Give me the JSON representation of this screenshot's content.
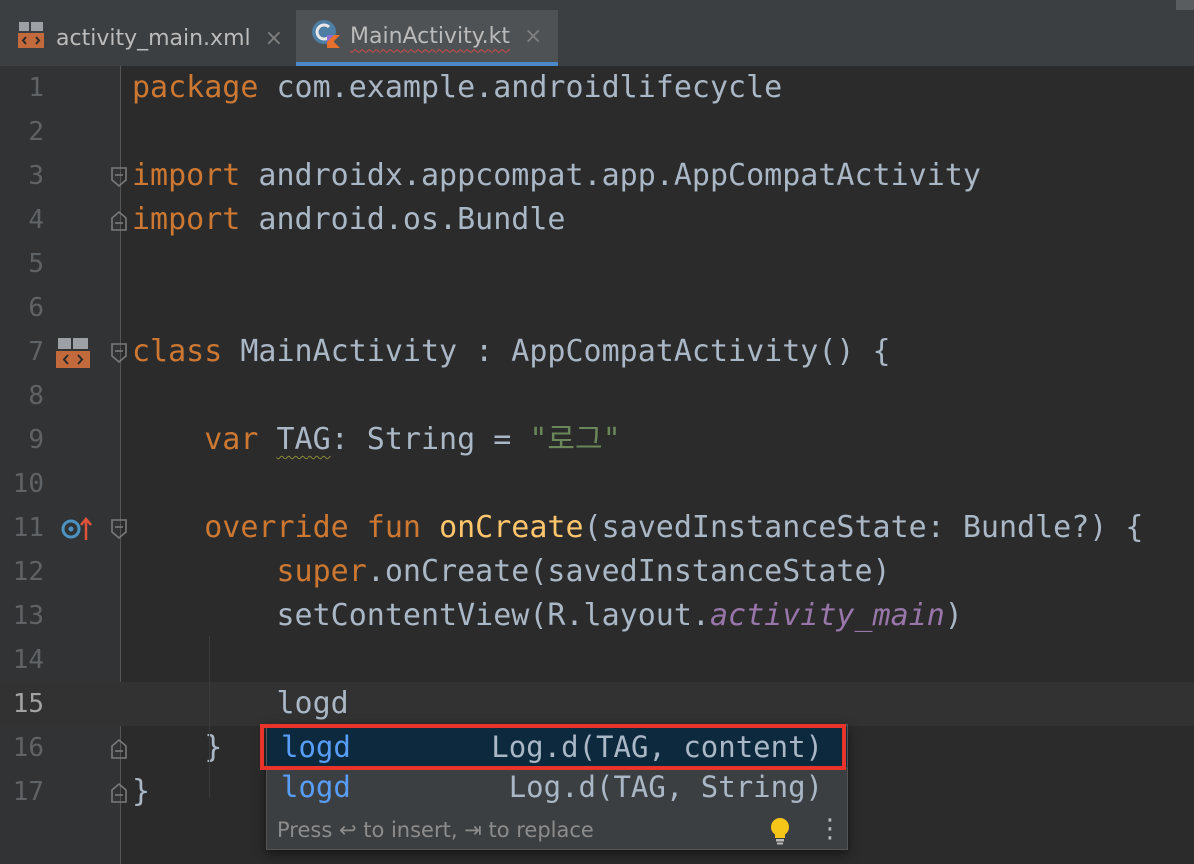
{
  "tabs": [
    {
      "label": "activity_main.xml",
      "icon": "xml-layout-file-icon",
      "close": "×",
      "active": false
    },
    {
      "label": "MainActivity.kt",
      "icon": "kotlin-class-file-icon",
      "close": "×",
      "active": true
    }
  ],
  "lines": [
    {
      "n": "1",
      "code": [
        {
          "t": "package",
          "c": "kw"
        },
        {
          "t": " com.example.androidlifecycle"
        }
      ]
    },
    {
      "n": "2",
      "code": []
    },
    {
      "n": "3",
      "code": [
        {
          "t": "import",
          "c": "kw"
        },
        {
          "t": " androidx.appcompat.app.AppCompatActivity"
        }
      ]
    },
    {
      "n": "4",
      "code": [
        {
          "t": "import",
          "c": "kw"
        },
        {
          "t": " android.os.Bundle"
        }
      ]
    },
    {
      "n": "5",
      "code": []
    },
    {
      "n": "6",
      "code": []
    },
    {
      "n": "7",
      "code": [
        {
          "t": "class",
          "c": "kw"
        },
        {
          "t": " MainActivity : AppCompatActivity() {"
        }
      ]
    },
    {
      "n": "8",
      "code": []
    },
    {
      "n": "9",
      "code": [
        {
          "t": "    "
        },
        {
          "t": "var",
          "c": "kw"
        },
        {
          "t": " "
        },
        {
          "t": "TAG",
          "c": "wavy"
        },
        {
          "t": ": String = "
        },
        {
          "t": "\"로그\"",
          "c": "str"
        }
      ]
    },
    {
      "n": "10",
      "code": []
    },
    {
      "n": "11",
      "code": [
        {
          "t": "    "
        },
        {
          "t": "override fun",
          "c": "kw"
        },
        {
          "t": " "
        },
        {
          "t": "onCreate",
          "c": "fn"
        },
        {
          "t": "(savedInstanceState: Bundle?) {"
        }
      ]
    },
    {
      "n": "12",
      "code": [
        {
          "t": "        "
        },
        {
          "t": "super",
          "c": "kw"
        },
        {
          "t": ".onCreate(savedInstanceState)"
        }
      ]
    },
    {
      "n": "13",
      "code": [
        {
          "t": "        setContentView(R.layout."
        },
        {
          "t": "activity_main",
          "c": "it"
        },
        {
          "t": ")"
        }
      ]
    },
    {
      "n": "14",
      "code": []
    },
    {
      "n": "15",
      "code": [
        {
          "t": "        logd"
        }
      ],
      "current": true
    },
    {
      "n": "16",
      "code": [
        {
          "t": "    }"
        }
      ]
    },
    {
      "n": "17",
      "code": [
        {
          "t": "}"
        }
      ]
    }
  ],
  "completion": {
    "items": [
      {
        "name": "logd",
        "desc": "Log.d(TAG, content)"
      },
      {
        "name": "logd",
        "desc": "Log.d(TAG, String)"
      }
    ],
    "hint": "Press ↩ to insert, ⇥ to replace",
    "bulb_icon": "lightbulb-icon",
    "menu_icon": "more-vertical-icon",
    "menu_glyph": "⋮"
  },
  "colors": {
    "keyword": "#cc7832",
    "function": "#ffc66d",
    "string": "#6a8759",
    "field": "#9876aa",
    "completion_name": "#589df6",
    "highlight_box": "#e8342b"
  }
}
